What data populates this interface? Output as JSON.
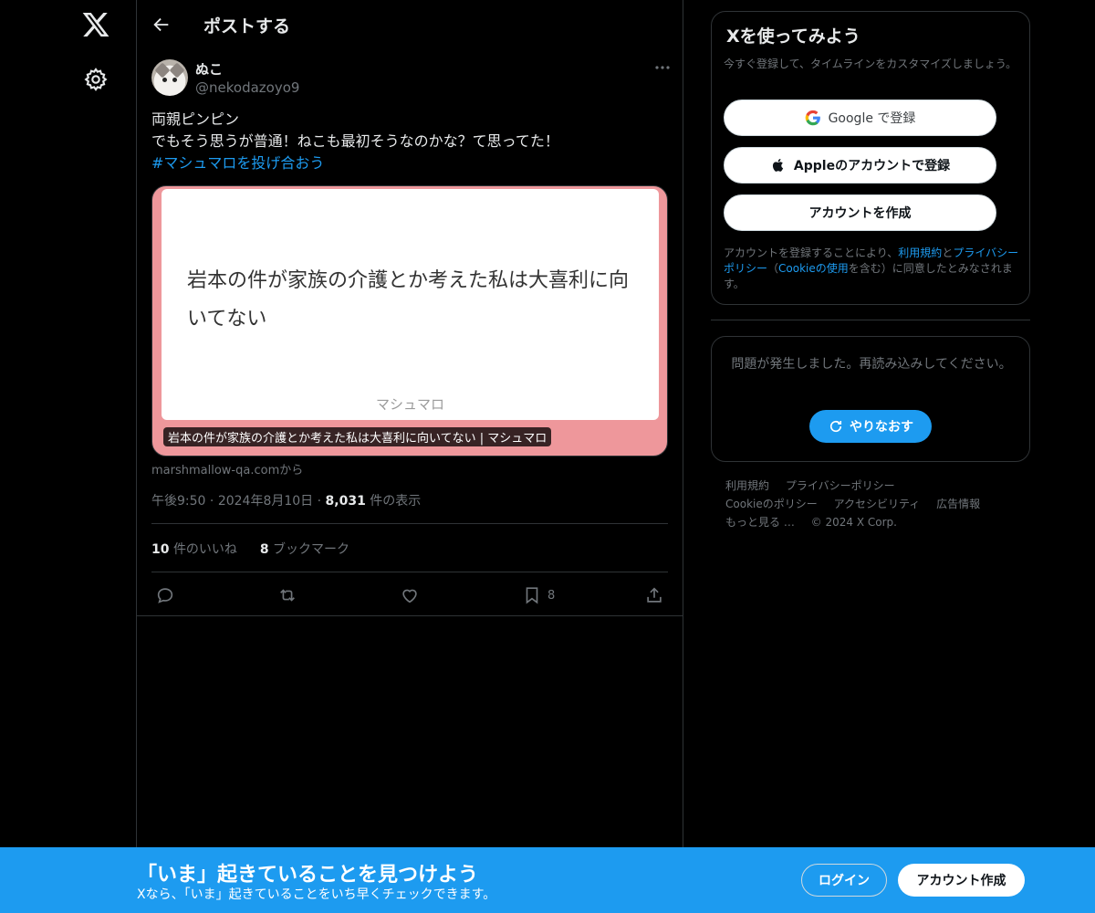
{
  "nav": {
    "logo_icon": "x-logo-icon",
    "settings_icon": "gear-icon"
  },
  "header": {
    "title": "ポストする",
    "back_icon": "back-arrow-icon"
  },
  "post": {
    "author_name": "ぬこ",
    "author_handle": "@nekodazoyo9",
    "lines": [
      "両親ピンピン",
      "でもそう思うが普通！ねこも最初そうなのかな？て思ってた！"
    ],
    "hashtag": "#マシュマロを投げ合おう",
    "card": {
      "question": "岩本の件が家族の介護とか考えた私は大喜利に向いてない",
      "brand": "マシュマロ",
      "caption": "岩本の件が家族の介護とか考えた私は大喜利に向いてない | マシュマロ",
      "source": "marshmallow-qa.comから"
    },
    "meta": {
      "time": "午後9:50",
      "date": "2024年8月10日",
      "views": "8,031",
      "views_label": "件の表示"
    },
    "stats": {
      "likes": "10",
      "likes_label": "件のいいね",
      "bookmarks": "8",
      "bookmarks_label": "ブックマーク"
    },
    "actions": {
      "bookmark_count": "8"
    }
  },
  "signup": {
    "title": "Xを使ってみよう",
    "subtitle": "今すぐ登録して、タイムラインをカスタマイズしましょう。",
    "google_label": "Google で登録",
    "apple_label": "Appleのアカウントで登録",
    "create_label": "アカウントを作成",
    "legal_prefix": "アカウントを登録することにより、",
    "legal_terms": "利用規約",
    "legal_and": "と",
    "legal_privacy": "プライバシーポリシー",
    "legal_open": "（",
    "legal_cookie": "Cookieの使用",
    "legal_suffix": "を含む）に同意したとみなされます。"
  },
  "error": {
    "message": "問題が発生しました。再読み込みしてください。",
    "retry_label": "やりなおす"
  },
  "footer": {
    "terms": "利用規約",
    "privacy": "プライバシーポリシー",
    "cookie": "Cookieのポリシー",
    "accessibility": "アクセシビリティ",
    "ads": "広告情報",
    "more": "もっと見る …",
    "copyright": "© 2024 X Corp."
  },
  "banner": {
    "title": "「いま」起きていることを見つけよう",
    "subtitle": "Xなら、「いま」起きていることをいち早くチェックできます。",
    "login_label": "ログイン",
    "create_label": "アカウント作成"
  },
  "colors": {
    "accent": "#1d9bf0",
    "card_background": "#ee979b",
    "background": "#000000"
  }
}
